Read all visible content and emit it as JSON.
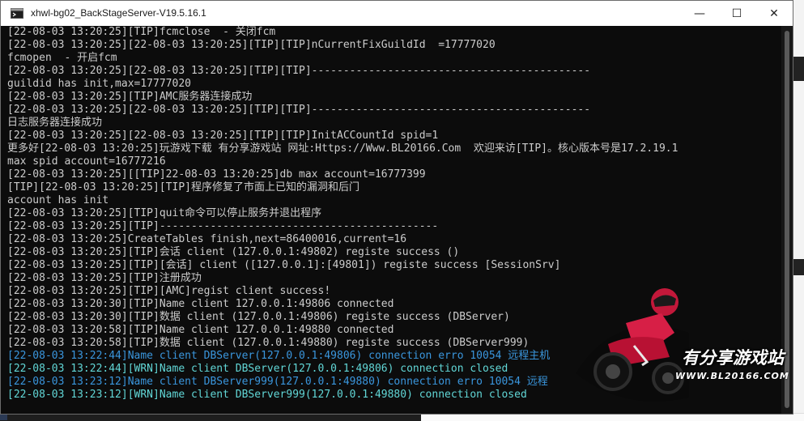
{
  "window": {
    "title": "xhwl-bg02_BackStageServer-V19.5.16.1",
    "buttons": {
      "minimize": "—",
      "maximize": "☐",
      "close": "✕"
    }
  },
  "console": {
    "lines": [
      {
        "text": "[22-08-03 13:20:25][TIP]fcmclose  - 关闭fcm",
        "color": "white"
      },
      {
        "text": "[22-08-03 13:20:25][22-08-03 13:20:25][TIP][TIP]nCurrentFixGuildId  =17777020",
        "color": "white"
      },
      {
        "text": "fcmopen  - 开启fcm",
        "color": "white"
      },
      {
        "text": "[22-08-03 13:20:25][22-08-03 13:20:25][TIP][TIP]--------------------------------------------",
        "color": "white"
      },
      {
        "text": "guildid has init,max=17777020",
        "color": "white"
      },
      {
        "text": "[22-08-03 13:20:25][TIP]AMC服务器连接成功",
        "color": "white"
      },
      {
        "text": "[22-08-03 13:20:25][22-08-03 13:20:25][TIP][TIP]--------------------------------------------",
        "color": "white"
      },
      {
        "text": "日志服务器连接成功",
        "color": "white"
      },
      {
        "text": "[22-08-03 13:20:25][22-08-03 13:20:25][TIP][TIP]InitACCountId spid=1",
        "color": "white"
      },
      {
        "text": "更多好[22-08-03 13:20:25]玩游戏下载 有分享游戏站 网址:Https://Www.BL20166.Com  欢迎来访[TIP]。核心版本号是17.2.19.1",
        "color": "white"
      },
      {
        "text": "max spid account=16777216",
        "color": "white"
      },
      {
        "text": "[22-08-03 13:20:25][[TIP]22-08-03 13:20:25]db max account=16777399",
        "color": "white"
      },
      {
        "text": "[TIP][22-08-03 13:20:25][TIP]程序修复了市面上已知的漏洞和后门",
        "color": "white"
      },
      {
        "text": "account has init",
        "color": "white"
      },
      {
        "text": "[22-08-03 13:20:25][TIP]quit命令可以停止服务并退出程序",
        "color": "white"
      },
      {
        "text": "[22-08-03 13:20:25][TIP]--------------------------------------------",
        "color": "white"
      },
      {
        "text": "[22-08-03 13:20:25]CreateTables finish,next=86400016,current=16",
        "color": "white"
      },
      {
        "text": "[22-08-03 13:20:25][TIP]会话 client (127.0.0.1:49802) registe success ()",
        "color": "white"
      },
      {
        "text": "[22-08-03 13:20:25][TIP][会话] client ([127.0.0.1]:[49801]) registe success [SessionSrv]",
        "color": "white"
      },
      {
        "text": "[22-08-03 13:20:25][TIP]注册成功",
        "color": "white"
      },
      {
        "text": "[22-08-03 13:20:25][TIP][AMC]regist client success!",
        "color": "white"
      },
      {
        "text": "[22-08-03 13:20:30][TIP]Name client 127.0.0.1:49806 connected",
        "color": "white"
      },
      {
        "text": "[22-08-03 13:20:30][TIP]数据 client (127.0.0.1:49806) registe success (DBServer)",
        "color": "white"
      },
      {
        "text": "[22-08-03 13:20:58][TIP]Name client 127.0.0.1:49880 connected",
        "color": "white"
      },
      {
        "text": "[22-08-03 13:20:58][TIP]数据 client (127.0.0.1:49880) registe success (DBServer999)",
        "color": "white"
      },
      {
        "text": "[22-08-03 13:22:44]Name client DBServer(127.0.0.1:49806) connection erro 10054 远程主机",
        "color": "cyan"
      },
      {
        "text": "[22-08-03 13:22:44][WRN]Name client DBServer(127.0.0.1:49806) connection closed",
        "color": "teal"
      },
      {
        "text": "[22-08-03 13:23:12]Name client DBServer999(127.0.0.1:49880) connection erro 10054 远程",
        "color": "cyan"
      },
      {
        "text": "[22-08-03 13:23:12][WRN]Name client DBServer999(127.0.0.1:49880) connection closed",
        "color": "teal"
      }
    ]
  },
  "watermark": {
    "title": "有分享游戏站",
    "url": "WWW.BL20166.COM"
  },
  "colors": {
    "console_bg": "#0c0c0c",
    "text_default": "#cccccc",
    "text_error": "#3a96dd",
    "text_warning": "#61d6d6"
  }
}
